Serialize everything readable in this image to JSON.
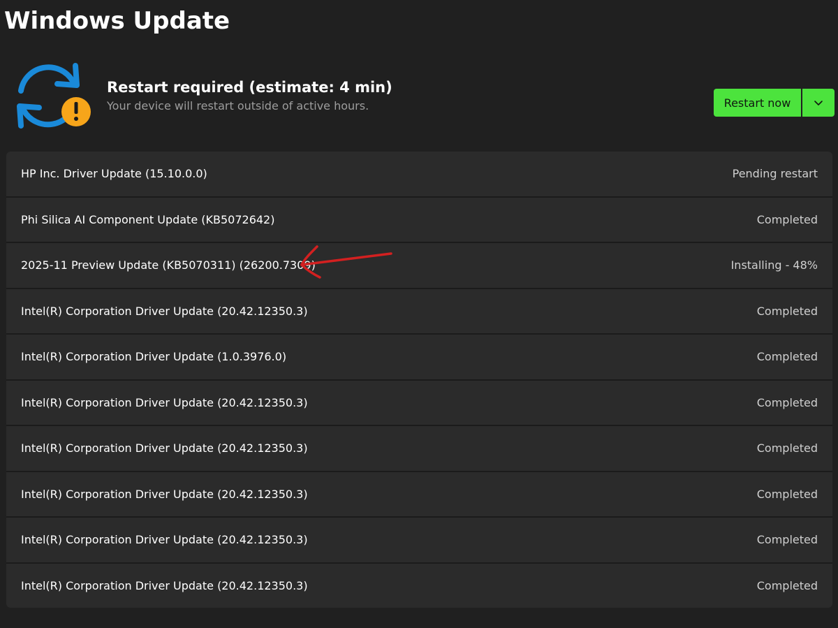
{
  "page": {
    "title": "Windows Update"
  },
  "status": {
    "icon": "sync-warning-icon",
    "title": "Restart required (estimate: 4 min)",
    "subtitle": "Your device will restart outside of active hours."
  },
  "actions": {
    "restart_label": "Restart now",
    "dropdown_icon": "chevron-down-icon"
  },
  "colors": {
    "accent": "#4ce33d",
    "warning": "#f7a51a",
    "sync_blue": "#1a8ad9",
    "annotation": "#d32020"
  },
  "updates": [
    {
      "name": "HP Inc. Driver Update (15.10.0.0)",
      "status": "Pending restart"
    },
    {
      "name": "Phi Silica AI Component Update (KB5072642)",
      "status": "Completed"
    },
    {
      "name": "2025-11 Preview Update (KB5070311) (26200.7309)",
      "status": "Installing - 48%",
      "progress_percent": 48
    },
    {
      "name": "Intel(R) Corporation Driver Update (20.42.12350.3)",
      "status": "Completed"
    },
    {
      "name": "Intel(R) Corporation Driver Update (1.0.3976.0)",
      "status": "Completed"
    },
    {
      "name": "Intel(R) Corporation Driver Update (20.42.12350.3)",
      "status": "Completed"
    },
    {
      "name": "Intel(R) Corporation Driver Update (20.42.12350.3)",
      "status": "Completed"
    },
    {
      "name": "Intel(R) Corporation Driver Update (20.42.12350.3)",
      "status": "Completed"
    },
    {
      "name": "Intel(R) Corporation Driver Update (20.42.12350.3)",
      "status": "Completed"
    },
    {
      "name": "Intel(R) Corporation Driver Update (20.42.12350.3)",
      "status": "Completed"
    }
  ]
}
